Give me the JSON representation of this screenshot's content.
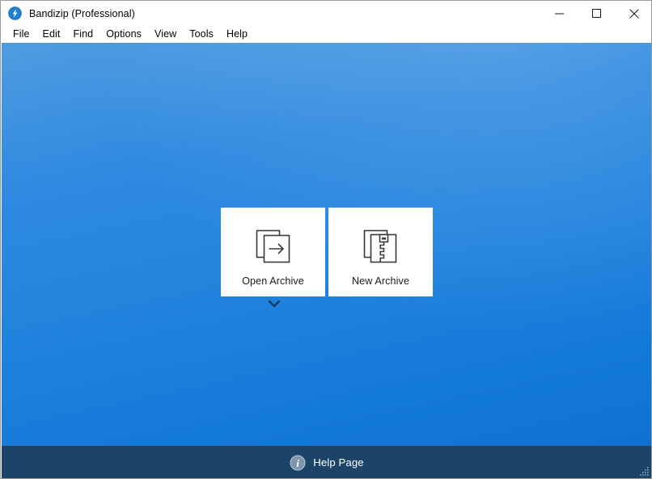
{
  "window": {
    "title": "Bandizip (Professional)",
    "app_icon": "bandizip-logo-icon",
    "controls": {
      "minimize": "minimize-icon",
      "maximize": "maximize-icon",
      "close": "close-icon"
    }
  },
  "menu": {
    "items": [
      {
        "label": "File"
      },
      {
        "label": "Edit"
      },
      {
        "label": "Find"
      },
      {
        "label": "Options"
      },
      {
        "label": "View"
      },
      {
        "label": "Tools"
      },
      {
        "label": "Help"
      }
    ]
  },
  "main": {
    "cards": [
      {
        "label": "Open Archive",
        "icon": "open-archive-icon"
      },
      {
        "label": "New Archive",
        "icon": "new-archive-icon"
      }
    ],
    "expand_icon": "chevron-down-icon"
  },
  "help_bar": {
    "label": "Help Page",
    "icon": "info-icon"
  },
  "colors": {
    "background_top": "#4f9ce0",
    "background_bottom": "#0f72d2",
    "help_bar": "#1c4469",
    "card_background": "#ffffff",
    "accent": "#1379d8",
    "title_bar": "#ffffff",
    "text": "#000000"
  }
}
